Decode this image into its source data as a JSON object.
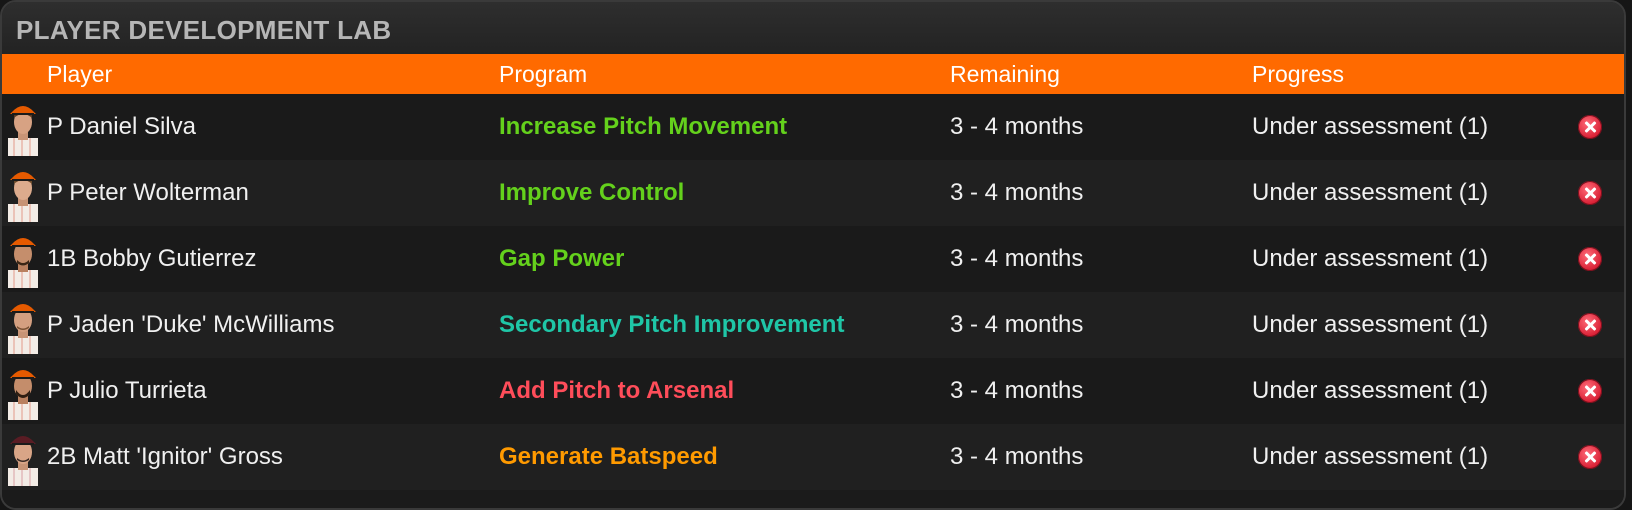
{
  "panel": {
    "title": "PLAYER DEVELOPMENT LAB"
  },
  "columns": {
    "player": "Player",
    "program": "Program",
    "remaining": "Remaining",
    "progress": "Progress"
  },
  "colors": {
    "accent": "#ff6a00",
    "program_green": "#64d11c",
    "program_teal": "#1fc6a7",
    "program_red": "#ff4d5a",
    "program_orange": "#ff9a00"
  },
  "rows": [
    {
      "player": "P Daniel Silva",
      "program": "Increase Pitch Movement",
      "program_color": "#64d11c",
      "remaining": "3 - 4 months",
      "progress": "Under assessment (1)",
      "avatar": "player-headshot",
      "hair_color": "#5a3a22"
    },
    {
      "player": "P Peter Wolterman",
      "program": "Improve Control",
      "program_color": "#64d11c",
      "remaining": "3 - 4 months",
      "progress": "Under assessment (1)",
      "avatar": "player-headshot",
      "hair_color": "#6b4a2a"
    },
    {
      "player": "1B Bobby Gutierrez",
      "program": "Gap Power",
      "program_color": "#64d11c",
      "remaining": "3 - 4 months",
      "progress": "Under assessment (1)",
      "avatar": "player-headshot",
      "hair_color": "#3a2616"
    },
    {
      "player": "P Jaden 'Duke' McWilliams",
      "program": "Secondary Pitch Improvement",
      "program_color": "#1fc6a7",
      "remaining": "3 - 4 months",
      "progress": "Under assessment (1)",
      "avatar": "player-headshot",
      "hair_color": "#6b4a2a"
    },
    {
      "player": "P Julio Turrieta",
      "program": "Add Pitch to Arsenal",
      "program_color": "#ff4d5a",
      "remaining": "3 - 4 months",
      "progress": "Under assessment (1)",
      "avatar": "player-headshot",
      "hair_color": "#3a2616"
    },
    {
      "player": "2B Matt 'Ignitor' Gross",
      "program": "Generate Batspeed",
      "program_color": "#ff9a00",
      "remaining": "3 - 4 months",
      "progress": "Under assessment (1)",
      "avatar": "player-headshot",
      "hair_color": "#3a2a24",
      "cap_color": "#5a1c24"
    }
  ]
}
